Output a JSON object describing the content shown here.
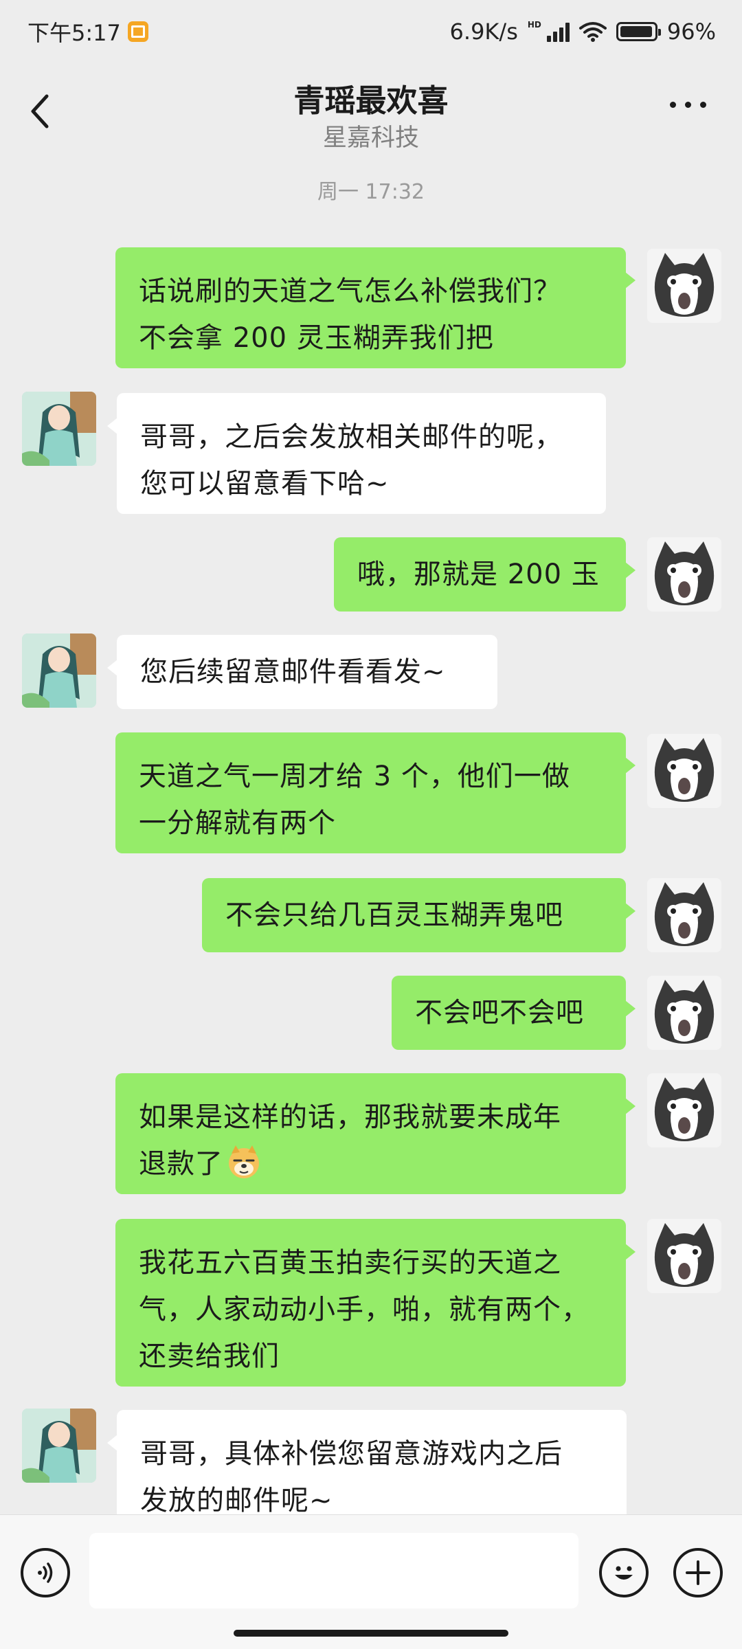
{
  "status_bar": {
    "time": "下午5:17",
    "net_speed": "6.9K/s",
    "hd_label": "HD",
    "battery_percent": "96%",
    "battery_level": 0.96
  },
  "header": {
    "title": "青瑶最欢喜",
    "subtitle": "星嘉科技",
    "back_icon": "chevron-left-icon",
    "more_icon": "more-dots-icon"
  },
  "chat": {
    "timestamp": "周一 17:32",
    "messages": [
      {
        "from": "me",
        "text": "话说刷的天道之气怎么补偿我们？\n不会拿 200 灵玉糊弄我们把"
      },
      {
        "from": "them",
        "text": "哥哥，之后会发放相关邮件的呢，\n您可以留意看下哈~"
      },
      {
        "from": "me",
        "text": "哦，那就是 200 玉"
      },
      {
        "from": "them",
        "text": "您后续留意邮件看看发~"
      },
      {
        "from": "me",
        "text": "天道之气一周才给 3 个，他们一做\n一分解就有两个"
      },
      {
        "from": "me",
        "text": "不会只给几百灵玉糊弄鬼吧"
      },
      {
        "from": "me",
        "text": "不会吧不会吧"
      },
      {
        "from": "me",
        "text": "如果是这样的话，那我就要未成年\n退款了"
      },
      {
        "from": "me",
        "text": "我花五六百黄玉拍卖行买的天道之\n气，人家动动小手，啪，就有两个，\n还卖给我们"
      },
      {
        "from": "them",
        "text": "哥哥，具体补偿您留意游戏内之后\n发放的邮件呢~"
      }
    ]
  },
  "input_bar": {
    "placeholder": "",
    "voice_icon": "voice-icon",
    "emoji_icon": "emoji-icon",
    "add_icon": "plus-icon"
  },
  "colors": {
    "background": "#ededed",
    "my_bubble": "#95ec69",
    "their_bubble": "#ffffff"
  }
}
